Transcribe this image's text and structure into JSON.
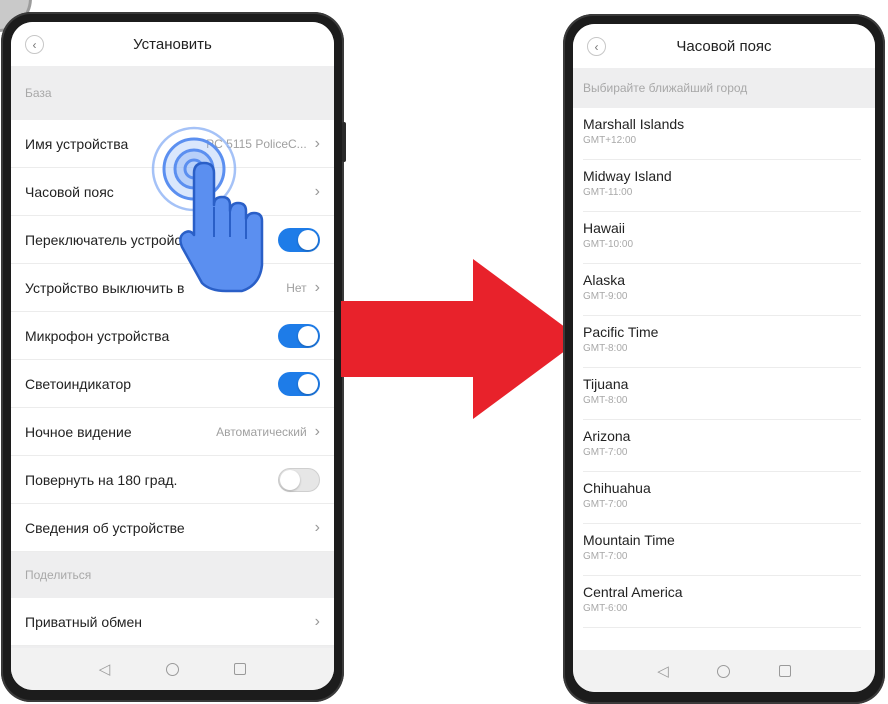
{
  "left_screen": {
    "title": "Установить",
    "sections": {
      "base": "База",
      "share": "Поделиться"
    },
    "rows": [
      {
        "label": "Имя устройства",
        "value": "PC 5115 PoliceC..."
      },
      {
        "label": "Часовой пояс",
        "value": ""
      },
      {
        "label": "Переключатель устройства",
        "toggle": "on"
      },
      {
        "label": "Устройство выключить в",
        "value": "Нет"
      },
      {
        "label": "Микрофон устройства",
        "toggle": "on"
      },
      {
        "label": "Светоиндикатор",
        "toggle": "on"
      },
      {
        "label": "Ночное видение",
        "value": "Автоматический"
      },
      {
        "label": "Повернуть на 180 град.",
        "toggle": "off"
      },
      {
        "label": "Сведения об устройстве",
        "value": ""
      }
    ],
    "share_rows": [
      {
        "label": "Приватный обмен"
      }
    ]
  },
  "right_screen": {
    "title": "Часовой пояс",
    "hint": "Выбирайте ближайший город",
    "zones": [
      {
        "name": "Marshall Islands",
        "offset": "GMT+12:00"
      },
      {
        "name": "Midway Island",
        "offset": "GMT-11:00"
      },
      {
        "name": "Hawaii",
        "offset": "GMT-10:00"
      },
      {
        "name": "Alaska",
        "offset": "GMT-9:00"
      },
      {
        "name": "Pacific Time",
        "offset": "GMT-8:00"
      },
      {
        "name": "Tijuana",
        "offset": "GMT-8:00"
      },
      {
        "name": "Arizona",
        "offset": "GMT-7:00"
      },
      {
        "name": "Chihuahua",
        "offset": "GMT-7:00"
      },
      {
        "name": "Mountain Time",
        "offset": "GMT-7:00"
      },
      {
        "name": "Central America",
        "offset": "GMT-6:00"
      }
    ]
  },
  "nav": {
    "back": "◁",
    "home": "○",
    "recent": "□"
  },
  "icons": {
    "back": "chevron-left-icon",
    "chevron": "chevron-right-icon",
    "tap": "tap-hand-icon",
    "arrow": "right-arrow-icon"
  },
  "colors": {
    "accent": "#1e7ce8",
    "arrow": "#e8222b",
    "hand": "#5b8ff0"
  }
}
